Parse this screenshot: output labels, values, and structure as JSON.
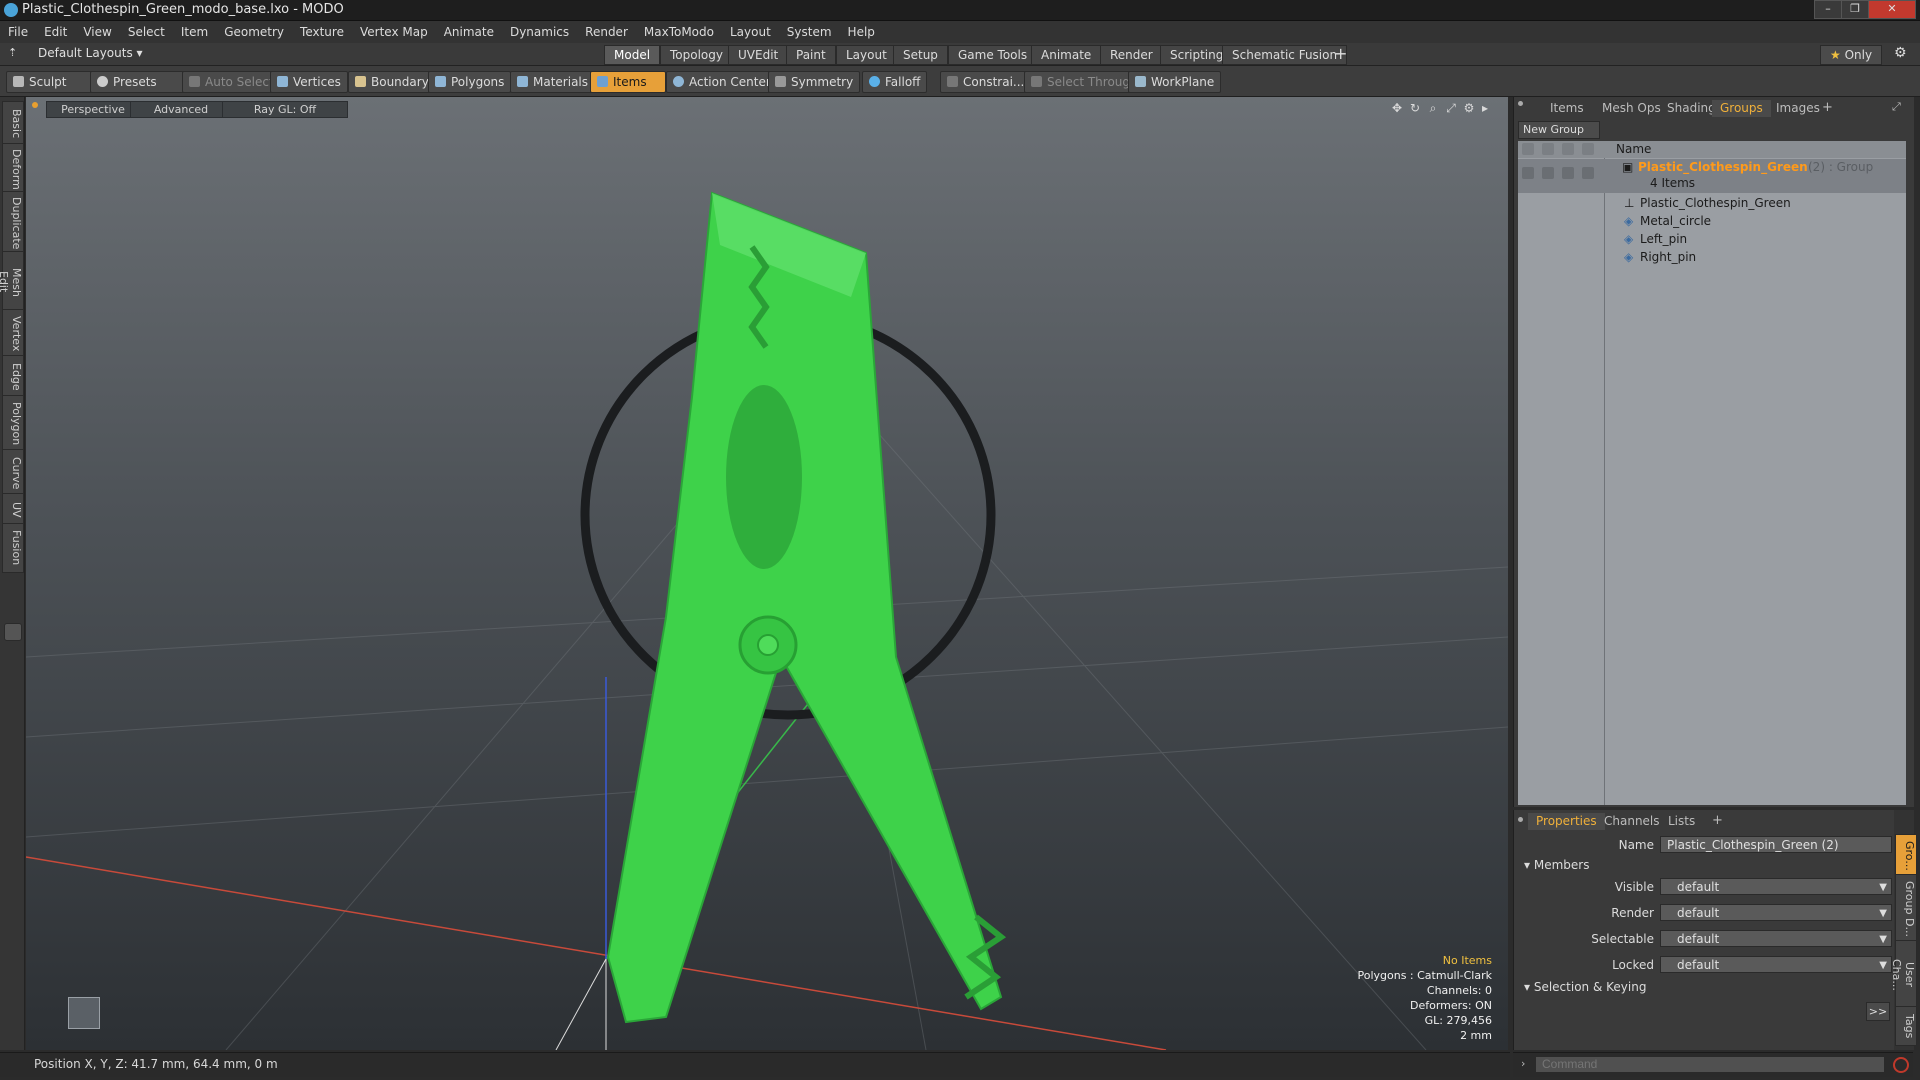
{
  "window": {
    "title": "Plastic_Clothespin_Green_modo_base.lxo - MODO"
  },
  "menu": [
    "File",
    "Edit",
    "View",
    "Select",
    "Item",
    "Geometry",
    "Texture",
    "Vertex Map",
    "Animate",
    "Dynamics",
    "Render",
    "MaxToModo",
    "Layout",
    "System",
    "Help"
  ],
  "layouts": {
    "preset": "Default Layouts",
    "tabs": [
      "Model",
      "Topology",
      "UVEdit",
      "Paint",
      "Layout",
      "Setup",
      "Game Tools",
      "Animate",
      "Render",
      "Scripting",
      "Schematic Fusion"
    ],
    "active": "Model",
    "only_label": "Only"
  },
  "toolbar": {
    "sculpt": "Sculpt",
    "presets": "Presets",
    "auto_select": "Auto Select",
    "vertices": "Vertices",
    "boundary": "Boundary",
    "polygons": "Polygons",
    "materials": "Materials",
    "items": "Items",
    "action_center": "Action Center",
    "symmetry": "Symmetry",
    "falloff": "Falloff",
    "constrain": "Constrai...",
    "select_through": "Select Through",
    "workplane": "WorkPlane"
  },
  "left_tabs": [
    "Basic",
    "Deform",
    "Duplicate",
    "Mesh Edit",
    "Vertex",
    "Edge",
    "Polygon",
    "Curve",
    "UV",
    "Fusion"
  ],
  "viewport": {
    "view_mode": "Perspective",
    "advanced": "Advanced",
    "raygl": "Ray GL: Off",
    "info": {
      "items": "No Items",
      "polygons": "Polygons : Catmull-Clark",
      "channels": "Channels: 0",
      "deformers": "Deformers: ON",
      "gl": "GL: 279,456",
      "scale": "2 mm"
    },
    "object_color": "#3ed24a"
  },
  "groups_panel": {
    "tabs": [
      "Items",
      "Mesh Ops",
      "Shading",
      "Groups",
      "Images"
    ],
    "active_tab": "Groups",
    "new_group": "New Group",
    "column_name": "Name",
    "group": {
      "name": "Plastic_Clothespin_Green",
      "suffix": "(2) : Group",
      "count": "4 Items"
    },
    "items": [
      "Plastic_Clothespin_Green",
      "Metal_circle",
      "Left_pin",
      "Right_pin"
    ]
  },
  "properties_panel": {
    "tabs": [
      "Properties",
      "Channels",
      "Lists"
    ],
    "active_tab": "Properties",
    "name_label": "Name",
    "name_value": "Plastic_Clothespin_Green (2)",
    "members_section": "Members",
    "fields": [
      {
        "label": "Visible",
        "value": "default"
      },
      {
        "label": "Render",
        "value": "default"
      },
      {
        "label": "Selectable",
        "value": "default"
      },
      {
        "label": "Locked",
        "value": "default"
      }
    ],
    "selection_section": "Selection & Keying",
    "expand_label": ">>",
    "side_tabs": [
      "Gro...",
      "Group D...",
      "User Cha...",
      "Tags"
    ]
  },
  "status": {
    "position": "Position X, Y, Z:  41.7 mm, 64.4 mm, 0 m"
  },
  "command": {
    "placeholder": "Command"
  }
}
